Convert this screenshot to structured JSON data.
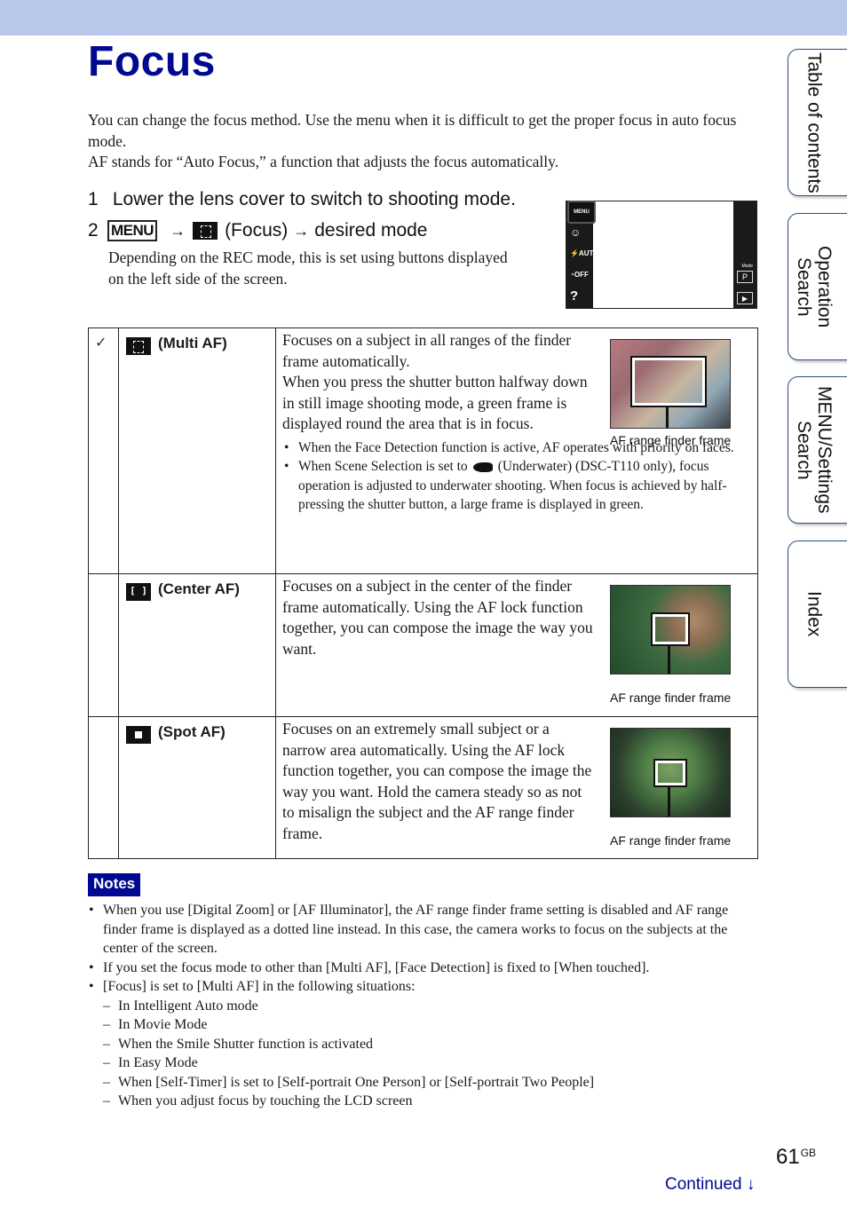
{
  "header": {
    "title": "Focus"
  },
  "intro": [
    "You can change the focus method. Use the menu when it is difficult to get the proper focus in auto focus mode.",
    "AF stands for “Auto Focus,” a function that adjusts the focus automatically."
  ],
  "steps": {
    "step1": {
      "num": "1",
      "text": "Lower the lens cover to switch to shooting mode."
    },
    "step2": {
      "num": "2",
      "menu_label": "MENU",
      "arrow": "→",
      "icon": "focus-icon",
      "focus_label": "(Focus)",
      "target": "desired mode",
      "note": "Depending on the REC mode, this is set using buttons displayed on the left side of the screen."
    }
  },
  "lcd": {
    "menu": "MENU",
    "left_icons": [
      "smile-icon",
      "flash-auto-icon",
      "self-timer-off-icon",
      "help-icon"
    ],
    "flash_label": "AUTO",
    "timer_label": "OFF",
    "help_label": "?",
    "mode_caption": "Mode",
    "mode_value": "P",
    "play_symbol": "▶"
  },
  "modes": [
    {
      "default": true,
      "check": "✓",
      "icon": "multi-af-icon",
      "name": "(Multi AF)",
      "desc": "Focuses on a subject in all ranges of the finder frame automatically.",
      "desc2": "When you press the shutter button halfway down in still image shooting mode, a green frame is displayed round the area that is in focus.",
      "bullets": [
        "When the Face Detection function is active, AF operates with priority on faces.",
        {
          "before": "When Scene Selection is set to",
          "icon": "underwater-fish-icon",
          "after": "(Underwater) (DSC-T110 only), focus operation is adjusted to underwater shooting. When focus is achieved by half-pressing the shutter button, a large frame is displayed in green."
        }
      ],
      "caption": "AF range finder frame"
    },
    {
      "default": false,
      "icon": "center-af-icon",
      "name": "(Center AF)",
      "desc": "Focuses on a subject in the center of the finder frame automatically. Using the AF lock function together, you can compose the image the way you want.",
      "caption": "AF range finder frame"
    },
    {
      "default": false,
      "icon": "spot-af-icon",
      "name": "(Spot AF)",
      "desc": "Focuses on an extremely small subject or a narrow area automatically. Using the AF lock function together, you can compose the image the way you want. Hold the camera steady so as not to misalign the subject and the AF range finder frame.",
      "caption": "AF range finder frame"
    }
  ],
  "notes": {
    "label": "Notes",
    "items": [
      "When you use [Digital Zoom] or [AF Illuminator], the AF range finder frame setting is disabled and AF range finder frame is displayed as a dotted line instead. In this case, the camera works to focus on the subjects at the center of the screen.",
      "If you set the focus mode to other than [Multi AF], [Face Detection] is fixed to [When touched].",
      "[Focus] is set to [Multi AF] in the following situations:"
    ],
    "situations": [
      "In Intelligent Auto mode",
      "In Movie Mode",
      "When the Smile Shutter function is activated",
      "In Easy Mode",
      "When [Self-Timer] is set to [Self-portrait One Person] or [Self-portrait Two People]",
      "When you adjust focus by touching the LCD screen"
    ]
  },
  "side_tabs": [
    "Table of contents",
    "Operation Search",
    "MENU/Settings Search",
    "Index"
  ],
  "footer": {
    "page": "61",
    "suffix": "GB",
    "continued": "Continued",
    "continued_arrow": "↓"
  },
  "colors": {
    "title": "#00098f",
    "topbar": "#b8c7ea",
    "tab_border": "#2f4f7f"
  }
}
